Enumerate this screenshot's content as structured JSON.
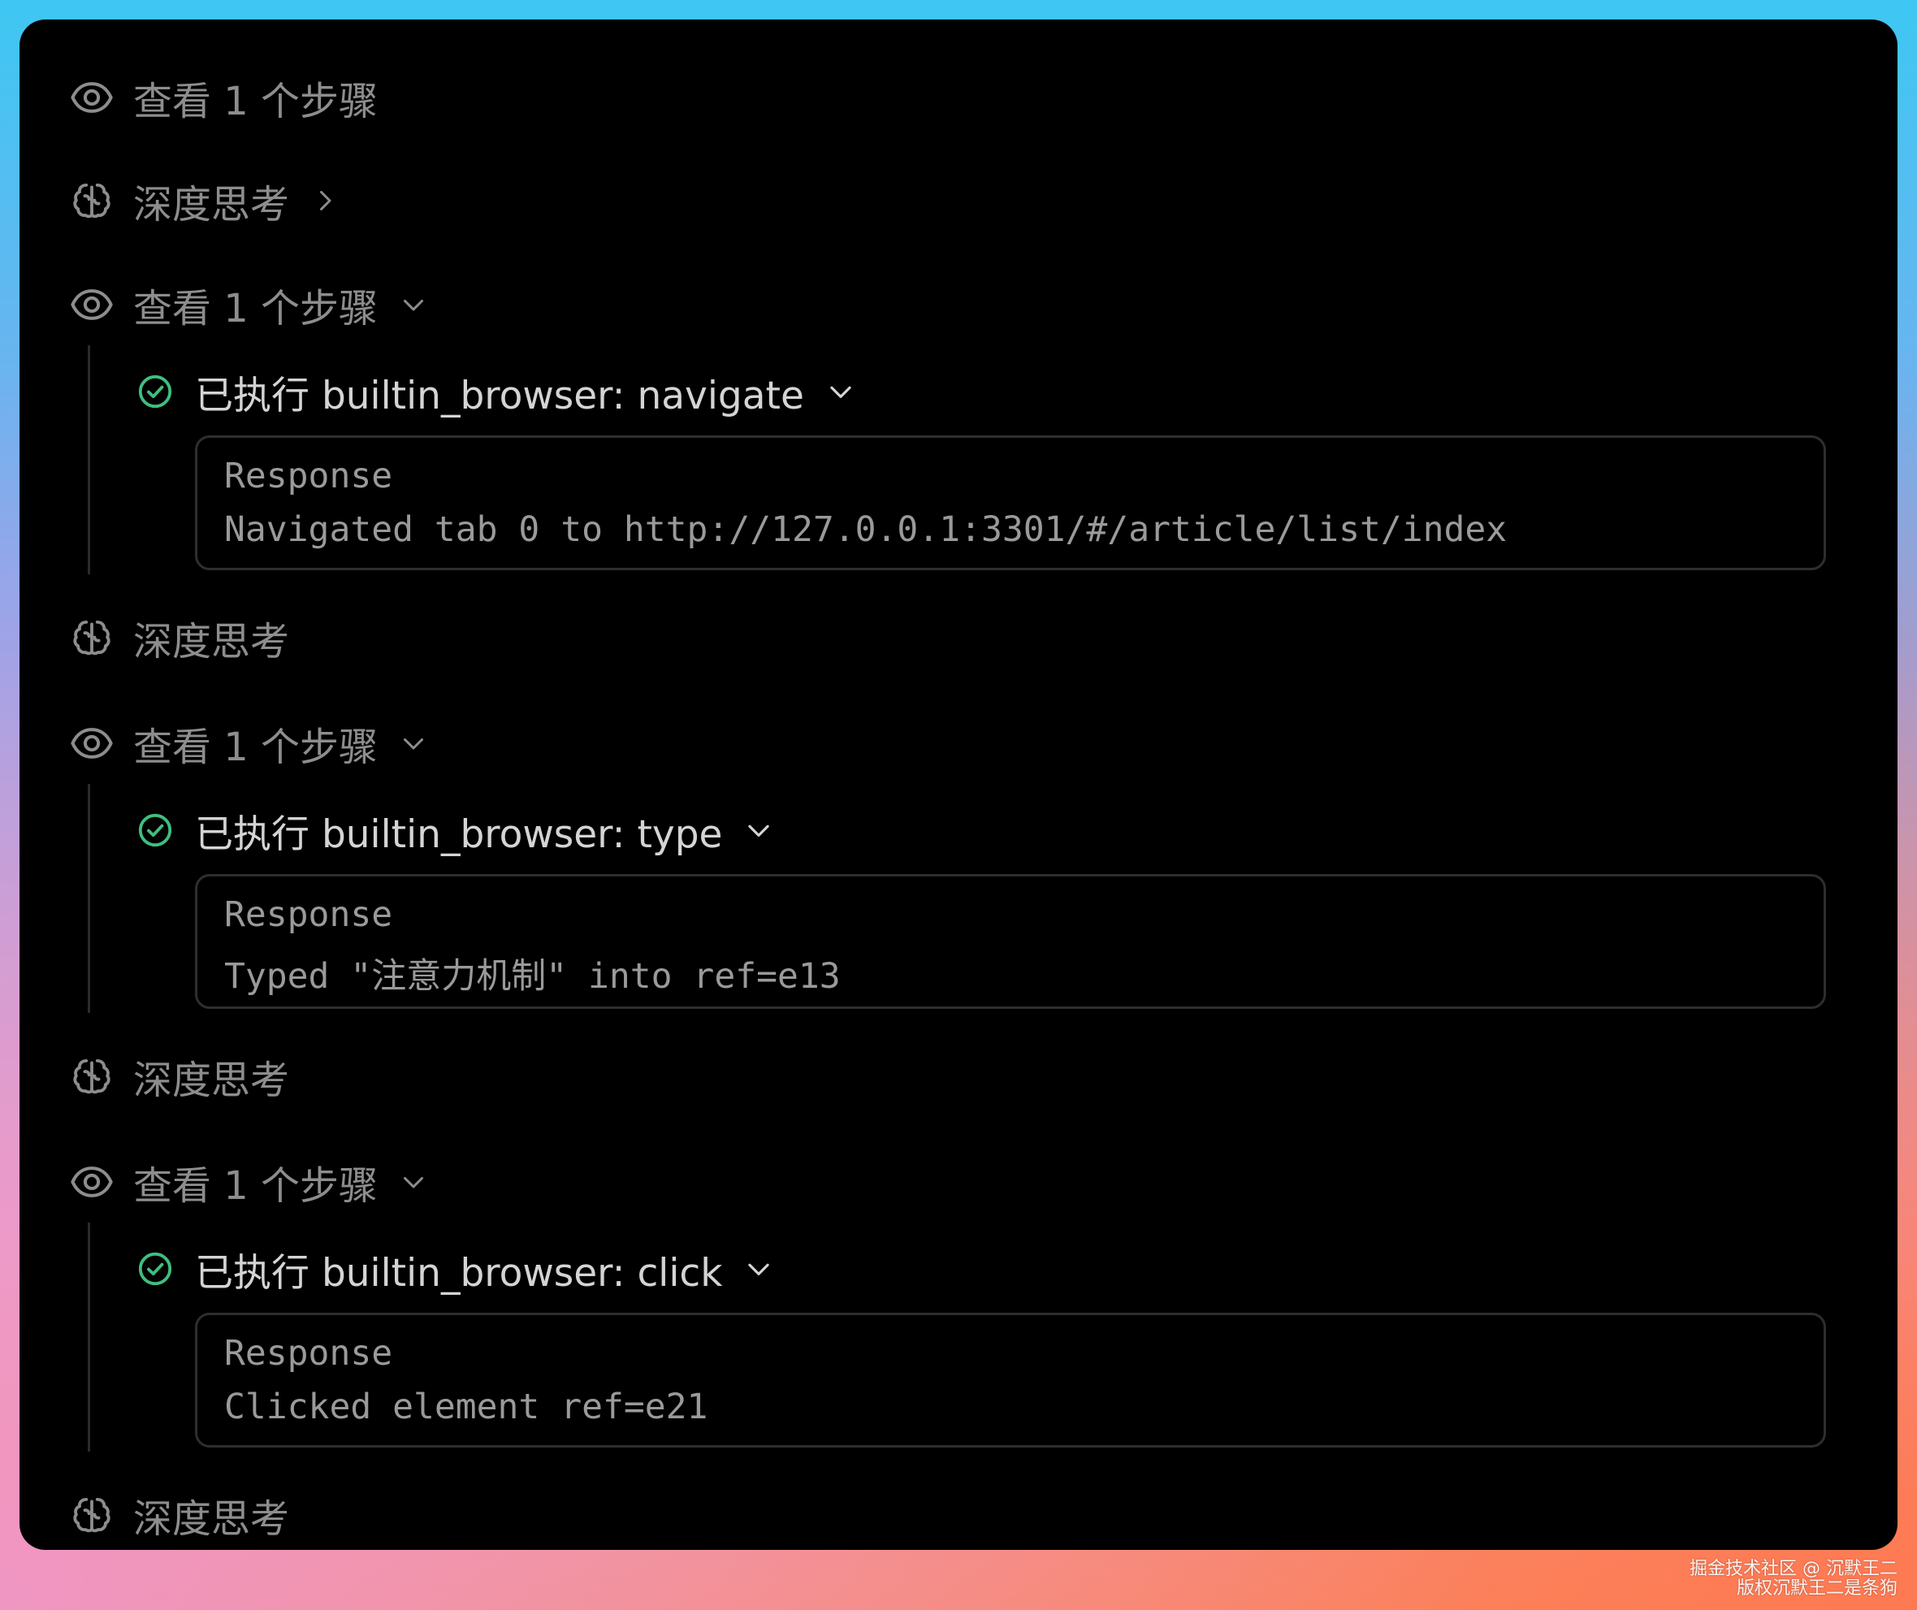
{
  "colors": {
    "panel_bg": "#000000",
    "muted_text": "#8d8d8d",
    "sub_text": "#d4d4d4",
    "success_green": "#3fbf7f",
    "box_border": "#2e2e2e"
  },
  "items": [
    {
      "kind": "view",
      "icon": "eye-icon",
      "label": "查看 1 个步骤"
    },
    {
      "kind": "think",
      "icon": "brain-icon",
      "label": "深度思考",
      "chevron": "chevron-right-icon"
    },
    {
      "kind": "view",
      "icon": "eye-icon",
      "label": "查看 1 个步骤",
      "chevron": "chevron-down-icon",
      "step": {
        "icon": "check-circle-icon",
        "label": "已执行 builtin_browser: navigate",
        "chevron": "chevron-down-icon",
        "response_title": "Response",
        "response_text": "Navigated tab 0 to http://127.0.0.1:3301/#/article/list/index"
      }
    },
    {
      "kind": "think",
      "icon": "brain-icon",
      "label": "深度思考"
    },
    {
      "kind": "view",
      "icon": "eye-icon",
      "label": "查看 1 个步骤",
      "chevron": "chevron-down-icon",
      "step": {
        "icon": "check-circle-icon",
        "label": "已执行 builtin_browser: type",
        "chevron": "chevron-down-icon",
        "response_title": "Response",
        "response_text": "Typed \"注意力机制\" into ref=e13"
      }
    },
    {
      "kind": "think",
      "icon": "brain-icon",
      "label": "深度思考"
    },
    {
      "kind": "view",
      "icon": "eye-icon",
      "label": "查看 1 个步骤",
      "chevron": "chevron-down-icon",
      "step": {
        "icon": "check-circle-icon",
        "label": "已执行 builtin_browser: click",
        "chevron": "chevron-down-icon",
        "response_title": "Response",
        "response_text": "Clicked element ref=e21"
      }
    },
    {
      "kind": "think",
      "icon": "brain-icon",
      "label": "深度思考"
    }
  ],
  "watermark": {
    "line1": "掘金技术社区 @ 沉默王二",
    "line2": "版权沉默王二是条狗"
  }
}
